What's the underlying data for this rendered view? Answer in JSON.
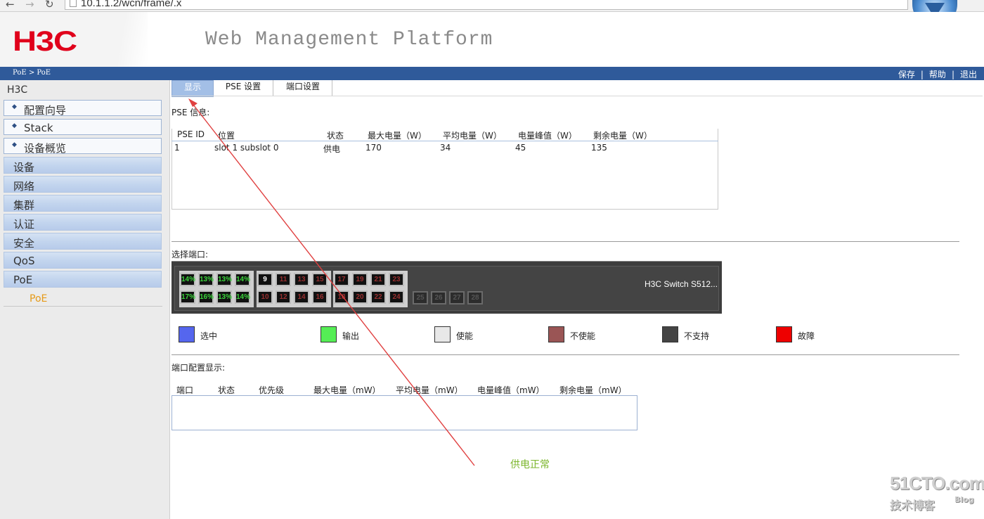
{
  "browser": {
    "url": "10.1.1.2/wcn/frame/.x"
  },
  "header": {
    "logo": "H3C",
    "platform": "Web Management Platform"
  },
  "breadcrumb": "PoE > PoE",
  "toplinks": [
    "保存",
    "|",
    "帮助",
    "|",
    "退出"
  ],
  "sidebar": {
    "title": "H3C",
    "top_items": [
      {
        "label": "配置向导"
      },
      {
        "label": "Stack"
      },
      {
        "label": "设备概览"
      }
    ],
    "items": [
      {
        "label": "设备"
      },
      {
        "label": "网络"
      },
      {
        "label": "集群"
      },
      {
        "label": "认证"
      },
      {
        "label": "安全"
      },
      {
        "label": "QoS"
      },
      {
        "label": "PoE"
      }
    ],
    "sub_item": "PoE"
  },
  "tabs": [
    {
      "label": "显示",
      "active": true
    },
    {
      "label": "PSE 设置"
    },
    {
      "label": "端口设置"
    }
  ],
  "pse": {
    "section_label": "PSE 信息:",
    "headers": [
      "PSE ID",
      "位置",
      "状态",
      "最大电量（W）",
      "平均电量（W）",
      "电量峰值（W）",
      "剩余电量（W）"
    ],
    "rows": [
      [
        "1",
        "slot 1 subslot 0",
        "供电",
        "170",
        "34",
        "45",
        "135"
      ]
    ]
  },
  "select_port": {
    "section_label": "选择端口:",
    "switch_name": "H3C Switch S512...",
    "port_groups": [
      {
        "top": [
          {
            "label": "14%",
            "state": "out"
          },
          {
            "label": "13%",
            "state": "out"
          },
          {
            "label": "13%",
            "state": "out"
          },
          {
            "label": "14%",
            "state": "out"
          }
        ],
        "bottom": [
          {
            "label": "17%",
            "state": "out"
          },
          {
            "label": "16%",
            "state": "out"
          },
          {
            "label": "13%",
            "state": "out"
          },
          {
            "label": "14%",
            "state": "out"
          }
        ]
      },
      {
        "top": [
          {
            "label": "9",
            "state": "en"
          },
          {
            "label": "11",
            "state": "dis"
          },
          {
            "label": "13",
            "state": "dis"
          },
          {
            "label": "15",
            "state": "dis"
          }
        ],
        "bottom": [
          {
            "label": "10",
            "state": "dis"
          },
          {
            "label": "12",
            "state": "dis"
          },
          {
            "label": "14",
            "state": "dis"
          },
          {
            "label": "16",
            "state": "dis"
          }
        ]
      },
      {
        "top": [
          {
            "label": "17",
            "state": "dis"
          },
          {
            "label": "19",
            "state": "dis"
          },
          {
            "label": "21",
            "state": "dis"
          },
          {
            "label": "23",
            "state": "dis"
          }
        ],
        "bottom": [
          {
            "label": "18",
            "state": "dis"
          },
          {
            "label": "20",
            "state": "dis"
          },
          {
            "label": "22",
            "state": "dis"
          },
          {
            "label": "24",
            "state": "dis"
          }
        ]
      }
    ],
    "sfp_ports": [
      {
        "label": "25"
      },
      {
        "label": "26"
      },
      {
        "label": "27"
      },
      {
        "label": "28"
      }
    ]
  },
  "legend": [
    {
      "label": "选中",
      "color": "#5566ee"
    },
    {
      "label": "输出",
      "color": "#55ee55"
    },
    {
      "label": "使能",
      "color": "#e8e8e8"
    },
    {
      "label": "不使能",
      "color": "#9a5555"
    },
    {
      "label": "不支持",
      "color": "#444444"
    },
    {
      "label": "故障",
      "color": "#ee0000"
    }
  ],
  "port_config": {
    "section_label": "端口配置显示:",
    "headers": [
      "端口",
      "状态",
      "优先级",
      "最大电量（mW）",
      "平均电量（mW）",
      "电量峰值（mW）",
      "剩余电量（mW）"
    ]
  },
  "annotation": "供电正常",
  "watermark": {
    "line1": "51CTO.com",
    "line2": "技术博客",
    "line3": "Blog"
  }
}
